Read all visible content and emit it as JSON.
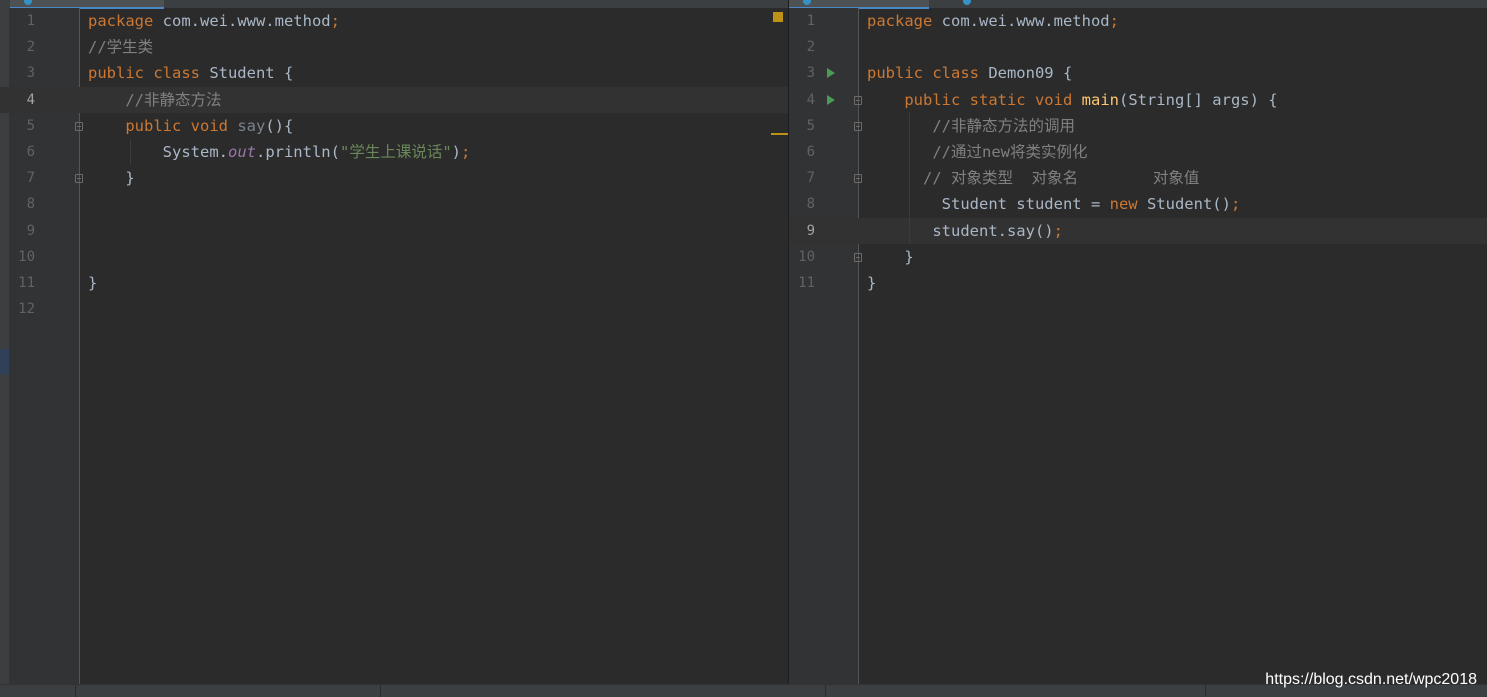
{
  "left_editor": {
    "lines": [
      {
        "n": "1",
        "parts": [
          {
            "t": "package",
            "c": "kw"
          },
          {
            "t": " com.wei.www.method"
          },
          {
            "t": ";",
            "c": "punct"
          }
        ]
      },
      {
        "n": "2",
        "parts": [
          {
            "t": "//学生类",
            "c": "cm"
          }
        ]
      },
      {
        "n": "3",
        "parts": [
          {
            "t": "public class",
            "c": "kw"
          },
          {
            "t": " Student {"
          }
        ]
      },
      {
        "n": "4",
        "current": true,
        "parts": [
          {
            "t": "    "
          },
          {
            "t": "//非静态方法",
            "c": "cm"
          }
        ]
      },
      {
        "n": "5",
        "parts": [
          {
            "t": "    "
          },
          {
            "t": "public void",
            "c": "kw"
          },
          {
            "t": " "
          },
          {
            "t": "say",
            "c": "fn-dim"
          },
          {
            "t": "(){"
          }
        ]
      },
      {
        "n": "6",
        "parts": [
          {
            "t": "        System."
          },
          {
            "t": "out",
            "c": "static-field"
          },
          {
            "t": ".println("
          },
          {
            "t": "\"学生上课说话\"",
            "c": "str"
          },
          {
            "t": ")"
          },
          {
            "t": ";",
            "c": "punct"
          }
        ]
      },
      {
        "n": "7",
        "parts": [
          {
            "t": "    }"
          }
        ]
      },
      {
        "n": "8",
        "parts": []
      },
      {
        "n": "9",
        "parts": []
      },
      {
        "n": "10",
        "parts": []
      },
      {
        "n": "11",
        "parts": [
          {
            "t": "}"
          }
        ]
      },
      {
        "n": "12",
        "parts": []
      }
    ]
  },
  "right_editor": {
    "lines": [
      {
        "n": "1",
        "parts": [
          {
            "t": "package",
            "c": "kw"
          },
          {
            "t": " com.wei.www.method"
          },
          {
            "t": ";",
            "c": "punct"
          }
        ]
      },
      {
        "n": "2",
        "parts": []
      },
      {
        "n": "3",
        "run": true,
        "parts": [
          {
            "t": "public class",
            "c": "kw"
          },
          {
            "t": " Demon09 {"
          }
        ]
      },
      {
        "n": "4",
        "run": true,
        "parts": [
          {
            "t": "    "
          },
          {
            "t": "public static void",
            "c": "kw"
          },
          {
            "t": " "
          },
          {
            "t": "main",
            "c": "method-decl"
          },
          {
            "t": "(String[] args) {"
          }
        ]
      },
      {
        "n": "5",
        "parts": [
          {
            "t": "       "
          },
          {
            "t": "//非静态方法的调用",
            "c": "cm"
          }
        ]
      },
      {
        "n": "6",
        "parts": [
          {
            "t": "       "
          },
          {
            "t": "//通过new将类实例化",
            "c": "cm"
          }
        ]
      },
      {
        "n": "7",
        "parts": [
          {
            "t": "      "
          },
          {
            "t": "// 对象类型  对象名        对象值",
            "c": "cm"
          }
        ]
      },
      {
        "n": "8",
        "parts": [
          {
            "t": "        Student student = "
          },
          {
            "t": "new",
            "c": "kw"
          },
          {
            "t": " Student()"
          },
          {
            "t": ";",
            "c": "punct"
          }
        ]
      },
      {
        "n": "9",
        "current": true,
        "parts": [
          {
            "t": "       student.say()"
          },
          {
            "t": ";",
            "c": "punct"
          }
        ]
      },
      {
        "n": "10",
        "parts": [
          {
            "t": "    }"
          }
        ]
      },
      {
        "n": "11",
        "parts": [
          {
            "t": "}"
          }
        ]
      }
    ]
  },
  "watermark": "https://blog.csdn.net/wpc2018",
  "colors": {
    "keyword": "#cc7832",
    "comment": "#808080",
    "string": "#6a8759",
    "text": "#a9b7c6",
    "static_field": "#9876aa",
    "method_decl": "#ffc66d",
    "run_icon": "#499c54",
    "warning": "#be9117"
  }
}
